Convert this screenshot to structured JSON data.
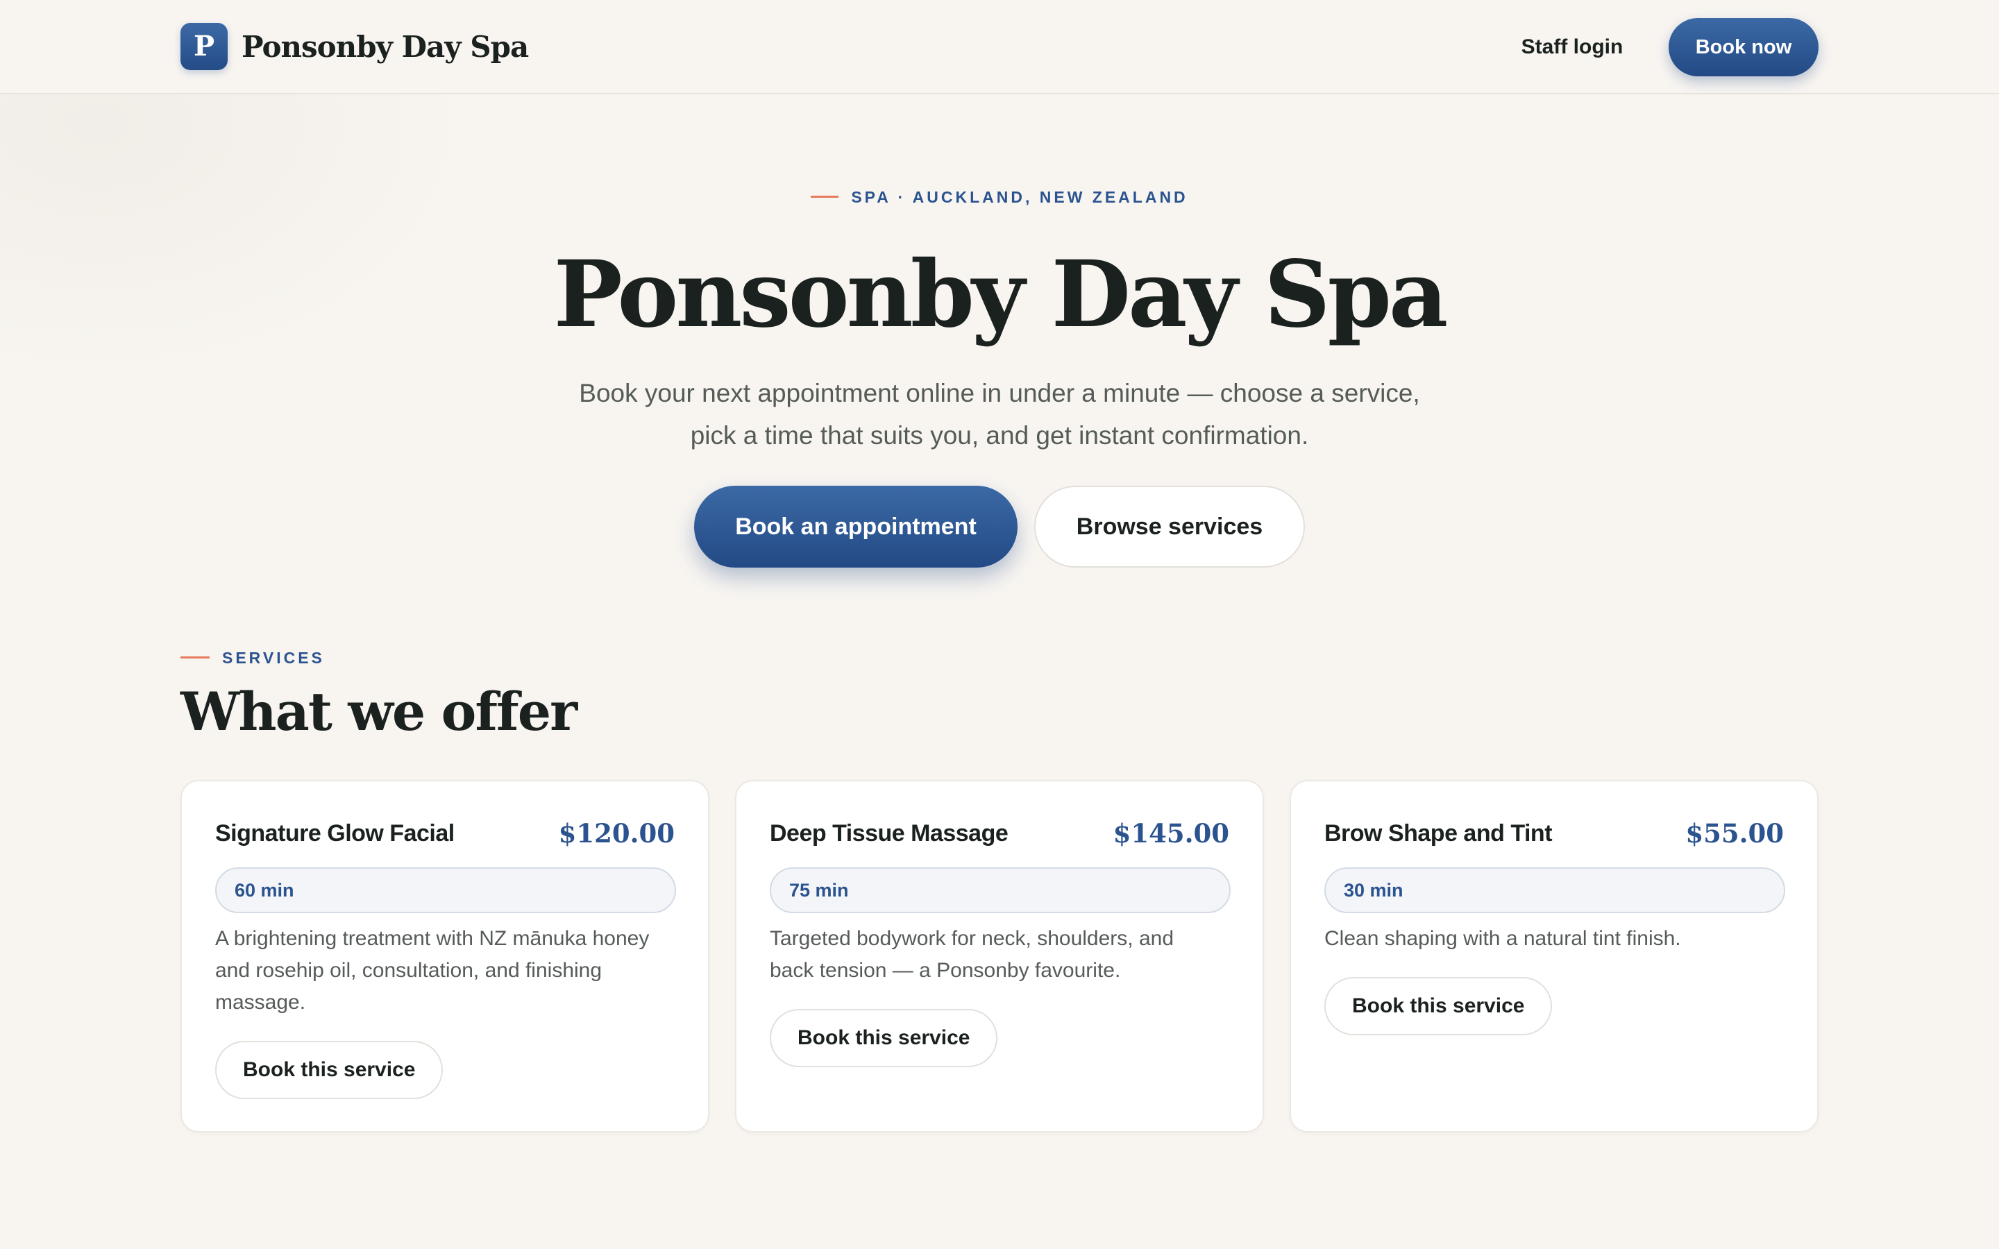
{
  "brand": {
    "logo_letter": "P",
    "name": "Ponsonby Day Spa",
    "accent_color": "#2b538f",
    "highlight_color": "#e67a5a"
  },
  "header": {
    "staff_login": "Staff login",
    "book_now": "Book now"
  },
  "hero": {
    "eyebrow": "SPA · AUCKLAND, NEW ZEALAND",
    "title": "Ponsonby Day Spa",
    "subtitle_line1": "Book your next appointment online in under a minute — choose a service,",
    "subtitle_line2": "pick a time that suits you, and get instant confirmation.",
    "primary_cta": "Book an appointment",
    "secondary_cta": "Browse services"
  },
  "services": {
    "eyebrow": "SERVICES",
    "title": "What we offer",
    "items": [
      {
        "name": "Signature Glow Facial",
        "price": "$120.00",
        "duration": "60 min",
        "description": "A brightening treatment with NZ mānuka honey and rosehip oil, consultation, and finishing massage.",
        "cta": "Book this service"
      },
      {
        "name": "Deep Tissue Massage",
        "price": "$145.00",
        "duration": "75 min",
        "description": "Targeted bodywork for neck, shoulders, and back tension — a Ponsonby favourite.",
        "cta": "Book this service"
      },
      {
        "name": "Brow Shape and Tint",
        "price": "$55.00",
        "duration": "30 min",
        "description": "Clean shaping with a natural tint finish.",
        "cta": "Book this service"
      }
    ]
  }
}
